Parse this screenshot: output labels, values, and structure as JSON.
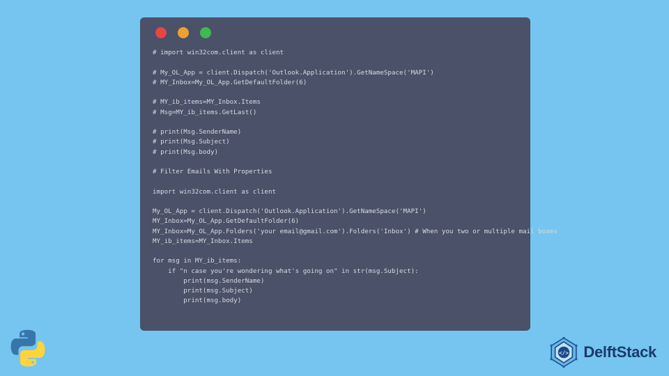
{
  "window": {
    "traffic_red": "red",
    "traffic_yellow": "yellow",
    "traffic_green": "green"
  },
  "code": {
    "l01": "# import win32com.client as client",
    "l02": "",
    "l03": "# My_OL_App = client.Dispatch('Outlook.Application').GetNameSpace('MAPI')",
    "l04": "# MY_Inbox=My_OL_App.GetDefaultFolder(6)",
    "l05": "",
    "l06": "# MY_ib_items=MY_Inbox.Items",
    "l07": "# Msg=MY_ib_items.GetLast()",
    "l08": "",
    "l09": "# print(Msg.SenderName)",
    "l10": "# print(Msg.Subject)",
    "l11": "# print(Msg.body)",
    "l12": "",
    "l13": "# Filter Emails With Properties",
    "l14": "",
    "l15": "import win32com.client as client",
    "l16": "",
    "l17": "My_OL_App = client.Dispatch('Outlook.Application').GetNameSpace('MAPI')",
    "l18": "MY_Inbox=My_OL_App.GetDefaultFolder(6)",
    "l19": "MY_Inbox=My_OL_App.Folders('your email@gmail.com').Folders('Inbox') # When you two or multiple mail boxes",
    "l20": "MY_ib_items=MY_Inbox.Items",
    "l21": "",
    "l22": "for msg in MY_ib_items:",
    "l23": "    if \"n case you're wondering what's going on\" in str(msg.Subject):",
    "l24": "        print(msg.SenderName)",
    "l25": "        print(msg.Subject)",
    "l26": "        print(msg.body)"
  },
  "branding": {
    "delftstack_label": "DelftStack"
  }
}
